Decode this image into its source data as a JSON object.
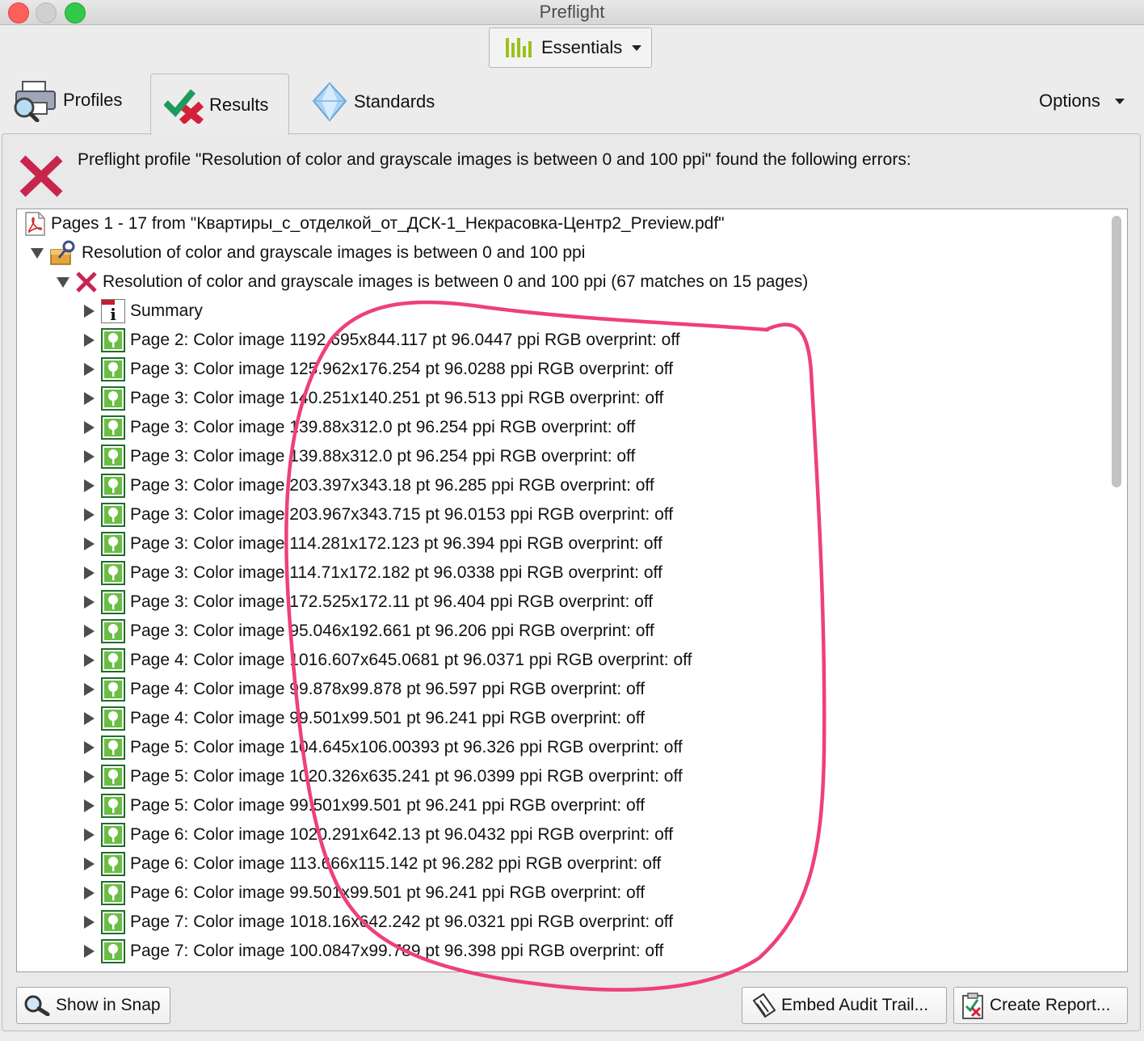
{
  "window": {
    "title": "Preflight"
  },
  "workspace": {
    "label": "Essentials"
  },
  "tabs": [
    {
      "label": "Profiles",
      "icon": "printer-magnifier-icon"
    },
    {
      "label": "Results",
      "icon": "check-cross-icon",
      "selected": true
    },
    {
      "label": "Standards",
      "icon": "diamond-icon"
    }
  ],
  "options_label": "Options",
  "error_message": "Preflight profile \"Resolution of color and grayscale images is between 0 and 100 ppi\" found the following errors:",
  "tree": {
    "file": "Pages 1 - 17 from \"Квартиры_с_отделкой_от_ДСК-1_Некрасовка-Центр2_Preview.pdf\"",
    "profile": "Resolution of color and grayscale images is between 0 and 100 ppi",
    "check": "Resolution of color and grayscale images is between 0 and 100 ppi (67 matches on 15 pages)",
    "summary": "Summary",
    "items": [
      "Page 2: Color image 1192.695x844.117 pt 96.0447 ppi RGB  overprint: off",
      "Page 3: Color image 125.962x176.254 pt 96.0288 ppi RGB  overprint: off",
      "Page 3: Color image 140.251x140.251 pt 96.513 ppi RGB  overprint: off",
      "Page 3: Color image 139.88x312.0 pt 96.254 ppi RGB  overprint: off",
      "Page 3: Color image 139.88x312.0 pt 96.254 ppi RGB  overprint: off",
      "Page 3: Color image 203.397x343.18 pt 96.285 ppi RGB  overprint: off",
      "Page 3: Color image 203.967x343.715 pt 96.0153 ppi RGB  overprint: off",
      "Page 3: Color image 114.281x172.123 pt 96.394 ppi RGB  overprint: off",
      "Page 3: Color image 114.71x172.182 pt 96.0338 ppi RGB  overprint: off",
      "Page 3: Color image 172.525x172.11 pt 96.404 ppi RGB  overprint: off",
      "Page 3: Color image 95.046x192.661 pt 96.206 ppi RGB  overprint: off",
      "Page 4: Color image 1016.607x645.0681 pt 96.0371 ppi RGB  overprint: off",
      "Page 4: Color image 99.878x99.878 pt 96.597 ppi RGB  overprint: off",
      "Page 4: Color image 99.501x99.501 pt 96.241 ppi RGB  overprint: off",
      "Page 5: Color image 104.645x106.00393 pt 96.326 ppi RGB  overprint: off",
      "Page 5: Color image 1020.326x635.241 pt 96.0399 ppi RGB  overprint: off",
      "Page 5: Color image 99.501x99.501 pt 96.241 ppi RGB  overprint: off",
      "Page 6: Color image 1020.291x642.13 pt 96.0432 ppi RGB  overprint: off",
      "Page 6: Color image 113.666x115.142 pt 96.282 ppi RGB  overprint: off",
      "Page 6: Color image 99.501x99.501 pt 96.241 ppi RGB  overprint: off",
      "Page 7: Color image 1018.16x642.242 pt 96.0321 ppi RGB  overprint: off",
      "Page 7: Color image 100.0847x99.789 pt 96.398 ppi RGB  overprint: off"
    ]
  },
  "buttons": {
    "show_in_snap": "Show in Snap",
    "embed_audit_trail": "Embed Audit Trail...",
    "create_report": "Create Report..."
  },
  "colors": {
    "error": "#c8254d",
    "annotation": "#ee3f7e",
    "image_icon": "#69be43"
  }
}
